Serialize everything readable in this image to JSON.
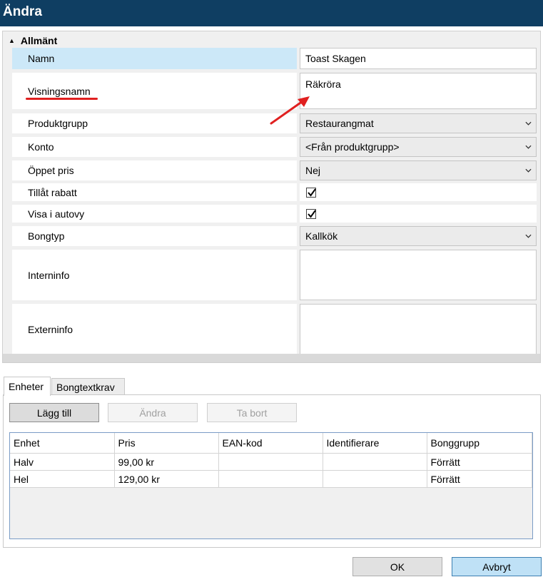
{
  "window": {
    "title": "Ändra"
  },
  "section": {
    "title": "Allmänt"
  },
  "props": {
    "namn": {
      "label": "Namn",
      "value": "Toast Skagen"
    },
    "visningsnamn": {
      "label": "Visningsnamn",
      "value": "Räkröra"
    },
    "produktgrupp": {
      "label": "Produktgrupp",
      "value": "Restaurangmat"
    },
    "konto": {
      "label": "Konto",
      "value": "<Från produktgrupp>"
    },
    "oppet_pris": {
      "label": "Öppet pris",
      "value": "Nej"
    },
    "tillat_rabatt": {
      "label": "Tillåt rabatt",
      "checked": true
    },
    "visa_i_autovy": {
      "label": "Visa i autovy",
      "checked": true
    },
    "bongtyp": {
      "label": "Bongtyp",
      "value": "Kallkök"
    },
    "interninfo": {
      "label": "Interninfo",
      "value": ""
    },
    "externinfo": {
      "label": "Externinfo",
      "value": ""
    }
  },
  "tabs": [
    "Enheter",
    "Bongtextkrav"
  ],
  "toolbar": {
    "add": "Lägg till",
    "edit": "Ändra",
    "delete": "Ta bort"
  },
  "grid": {
    "columns": [
      "Enhet",
      "Pris",
      "EAN-kod",
      "Identifierare",
      "Bonggrupp"
    ],
    "rows": [
      [
        "Halv",
        "99,00 kr",
        "",
        "",
        "Förrätt"
      ],
      [
        "Hel",
        "129,00 kr",
        "",
        "",
        "Förrätt"
      ]
    ]
  },
  "footer": {
    "ok": "OK",
    "cancel": "Avbryt"
  },
  "colors": {
    "titlebar": "#0f3e62",
    "selected_row": "#cce8f8",
    "annotation": "#e02020",
    "accent_button": "#bfe1f6"
  }
}
